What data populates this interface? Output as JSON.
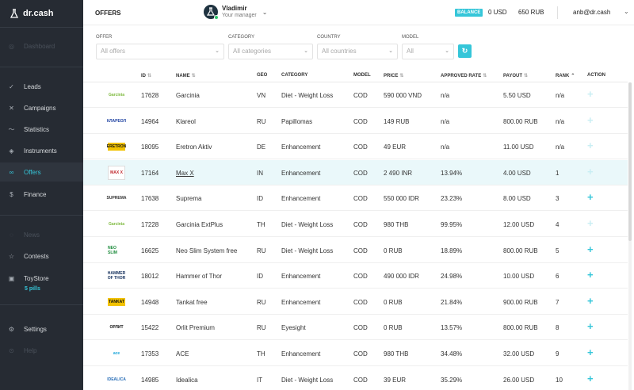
{
  "brand": {
    "name": "dr.cash"
  },
  "sidebar": {
    "items": [
      {
        "label": "Dashboard",
        "icon": "dashboard-icon",
        "dim": true
      },
      {
        "label": "Leads",
        "icon": "check-icon"
      },
      {
        "label": "Campaigns",
        "icon": "shuffle-icon"
      },
      {
        "label": "Statistics",
        "icon": "chart-line-icon"
      },
      {
        "label": "Instruments",
        "icon": "layers-icon"
      },
      {
        "label": "Offers",
        "icon": "link-icon",
        "active": true
      },
      {
        "label": "Finance",
        "icon": "dollar-icon"
      },
      {
        "label": "News",
        "icon": "bell-icon",
        "dim": true
      },
      {
        "label": "Contests",
        "icon": "star-icon"
      },
      {
        "label": "ToyStore",
        "icon": "gift-icon"
      },
      {
        "label": "Settings",
        "icon": "gear-icon"
      },
      {
        "label": "Help",
        "icon": "help-icon",
        "dim": true
      }
    ],
    "toystore_sub": "5 pills"
  },
  "header": {
    "title": "OFFERS",
    "manager": {
      "name": "Vladimir",
      "role": "Your manager"
    },
    "balance_label": "BALANCE",
    "balance_usd": "0 USD",
    "balance_rub": "650 RUB",
    "user_email": "anb@dr.cash"
  },
  "filters": {
    "offer": {
      "label": "OFFER",
      "placeholder": "All offers"
    },
    "category": {
      "label": "CATEGORY",
      "placeholder": "All categories"
    },
    "country": {
      "label": "COUNTRY",
      "placeholder": "All countries"
    },
    "model": {
      "label": "MODEL",
      "placeholder": "All"
    }
  },
  "table": {
    "columns": {
      "id": "ID",
      "name": "NAME",
      "geo": "GEO",
      "category": "CATEGORY",
      "model": "MODEL",
      "price": "PRICE",
      "approved": "APPROVED RATE",
      "payout": "PAYOUT",
      "rank": "RANK",
      "action": "ACTION"
    },
    "rows": [
      {
        "logo": "Garcinia",
        "id": "17628",
        "name": "Garcinia",
        "geo": "VN",
        "category": "Diet - Weight Loss",
        "model": "COD",
        "price": "590 000 VND",
        "approved": "n/a",
        "payout": "5.50 USD",
        "rank": "n/a",
        "action": "+"
      },
      {
        "logo": "КЛАРЕОЛ",
        "id": "14964",
        "name": "Klareol",
        "geo": "RU",
        "category": "Papillomas",
        "model": "COD",
        "price": "149 RUB",
        "approved": "n/a",
        "payout": "800.00 RUB",
        "rank": "n/a",
        "action": "+"
      },
      {
        "logo": "ERETRON",
        "id": "18095",
        "name": "Eretron Aktiv",
        "geo": "DE",
        "category": "Enhancement",
        "model": "COD",
        "price": "49 EUR",
        "approved": "n/a",
        "payout": "11.00 USD",
        "rank": "n/a",
        "action": "+"
      },
      {
        "logo": "MAX X",
        "id": "17164",
        "name": "Max X",
        "geo": "IN",
        "category": "Enhancement",
        "model": "COD",
        "price": "2 490 INR",
        "approved": "13.94%",
        "payout": "4.00 USD",
        "rank": "1",
        "action": "+"
      },
      {
        "logo": "SUPREMA",
        "id": "17638",
        "name": "Suprema",
        "geo": "ID",
        "category": "Enhancement",
        "model": "COD",
        "price": "550 000 IDR",
        "approved": "23.23%",
        "payout": "8.00 USD",
        "rank": "3",
        "action": "+"
      },
      {
        "logo": "Garcinia",
        "id": "17228",
        "name": "Garcinia ExtPlus",
        "geo": "TH",
        "category": "Diet - Weight Loss",
        "model": "COD",
        "price": "980 THB",
        "approved": "99.95%",
        "payout": "12.00 USD",
        "rank": "4",
        "action": "+"
      },
      {
        "logo": "NEO SLIM",
        "id": "16625",
        "name": "Neo Slim System free",
        "geo": "RU",
        "category": "Diet - Weight Loss",
        "model": "COD",
        "price": "0 RUB",
        "approved": "18.89%",
        "payout": "800.00 RUB",
        "rank": "5",
        "action": "+"
      },
      {
        "logo": "HAMMER OF THOR",
        "id": "18012",
        "name": "Hammer of Thor",
        "geo": "ID",
        "category": "Enhancement",
        "model": "COD",
        "price": "490 000 IDR",
        "approved": "24.98%",
        "payout": "10.00 USD",
        "rank": "6",
        "action": "+"
      },
      {
        "logo": "TANKAT",
        "id": "14948",
        "name": "Tankat free",
        "geo": "RU",
        "category": "Enhancement",
        "model": "COD",
        "price": "0 RUB",
        "approved": "21.84%",
        "payout": "900.00 RUB",
        "rank": "7",
        "action": "+"
      },
      {
        "logo": "ОРЛИТ",
        "id": "15422",
        "name": "Orlit Premium",
        "geo": "RU",
        "category": "Eyesight",
        "model": "COD",
        "price": "0 RUB",
        "approved": "13.57%",
        "payout": "800.00 RUB",
        "rank": "8",
        "action": "+"
      },
      {
        "logo": "ace",
        "id": "17353",
        "name": "ACE",
        "geo": "TH",
        "category": "Enhancement",
        "model": "COD",
        "price": "980 THB",
        "approved": "34.48%",
        "payout": "32.00 USD",
        "rank": "9",
        "action": "+"
      },
      {
        "logo": "IDEALICA",
        "id": "14985",
        "name": "Idealica",
        "geo": "IT",
        "category": "Diet - Weight Loss",
        "model": "COD",
        "price": "39 EUR",
        "approved": "35.29%",
        "payout": "26.00 USD",
        "rank": "10",
        "action": "+"
      }
    ]
  },
  "colors": {
    "accent": "#35c6d9",
    "sidebar_bg": "#262b33",
    "highlight_row": "#eaf8fa"
  }
}
